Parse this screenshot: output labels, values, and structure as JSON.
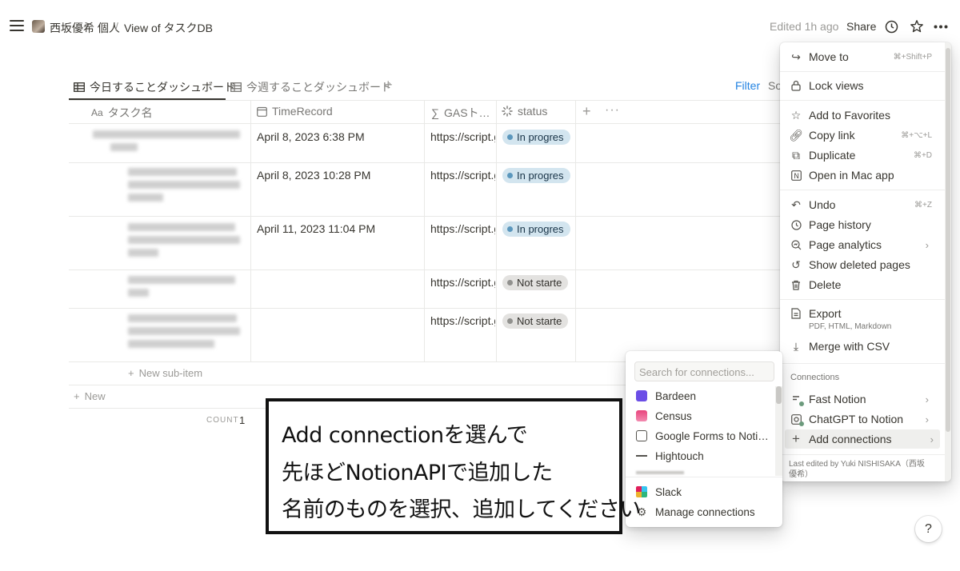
{
  "breadcrumb": {
    "workspace": "西坂優希 個人",
    "separator": "/",
    "page": "View of タスクDB"
  },
  "topbar": {
    "edited": "Edited 1h ago",
    "share": "Share"
  },
  "tabs": [
    {
      "label": "今日することダッシュボード"
    },
    {
      "label": "今週することダッシュボード"
    }
  ],
  "toolbar": {
    "filter": "Filter",
    "sort_partial": "So"
  },
  "columns": {
    "name": "タスク名",
    "name_icon": "Aa",
    "time": "TimeRecord",
    "gas": "GASト…",
    "status": "status"
  },
  "rows": [
    {
      "time": "April 8, 2023 6:38 PM",
      "gas": "https://script.g",
      "status": "In progres"
    },
    {
      "time": "April 8, 2023 10:28 PM",
      "gas": "https://script.g",
      "status": "In progres"
    },
    {
      "time": "April 11, 2023 11:04 PM",
      "gas": "https://script.g",
      "status": "In progres"
    },
    {
      "time": "",
      "gas": "https://script.g",
      "status": "Not starte"
    },
    {
      "time": "",
      "gas": "https://script.g",
      "status": "Not starte"
    }
  ],
  "table_footer": {
    "new_sub_item": "New sub-item",
    "new": "New",
    "count_label": "COUNT",
    "count_value": "1"
  },
  "menu": {
    "move_to": {
      "label": "Move to",
      "shortcut": "⌘+Shift+P"
    },
    "lock_views": {
      "label": "Lock views"
    },
    "add_fav": {
      "label": "Add to Favorites"
    },
    "copy_link": {
      "label": "Copy link",
      "shortcut": "⌘+⌥+L"
    },
    "duplicate": {
      "label": "Duplicate",
      "shortcut": "⌘+D"
    },
    "open_mac": {
      "label": "Open in Mac app"
    },
    "undo": {
      "label": "Undo",
      "shortcut": "⌘+Z"
    },
    "page_history": {
      "label": "Page history"
    },
    "page_analytics": {
      "label": "Page analytics"
    },
    "show_deleted": {
      "label": "Show deleted pages"
    },
    "delete": {
      "label": "Delete"
    },
    "export": {
      "label": "Export",
      "sub": "PDF, HTML, Markdown"
    },
    "merge_csv": {
      "label": "Merge with CSV"
    },
    "connections_heading": "Connections",
    "fast_notion": {
      "label": "Fast Notion"
    },
    "chatgpt": {
      "label": "ChatGPT to Notion"
    },
    "add_connections": {
      "label": "Add connections"
    },
    "last_edited": "Last edited by Yuki NISHISAKA（西坂",
    "last_edited_2": "優希）"
  },
  "connections_popup": {
    "search_placeholder": "Search for connections...",
    "items": [
      {
        "label": "Bardeen"
      },
      {
        "label": "Census"
      },
      {
        "label": "Google Forms to Noti…"
      },
      {
        "label": "Hightouch"
      }
    ],
    "slack": "Slack",
    "manage": "Manage connections"
  },
  "annotation": {
    "line1": "Add connectionを選んで",
    "line2": "先ほどNotionAPIで追加した",
    "line3": "名前のものを選択、追加してください"
  },
  "help": "?",
  "colors": {
    "in_progress_bg": "#d3e5ef",
    "not_started_bg": "#e3e2e0",
    "filter_blue": "#2383e2"
  }
}
